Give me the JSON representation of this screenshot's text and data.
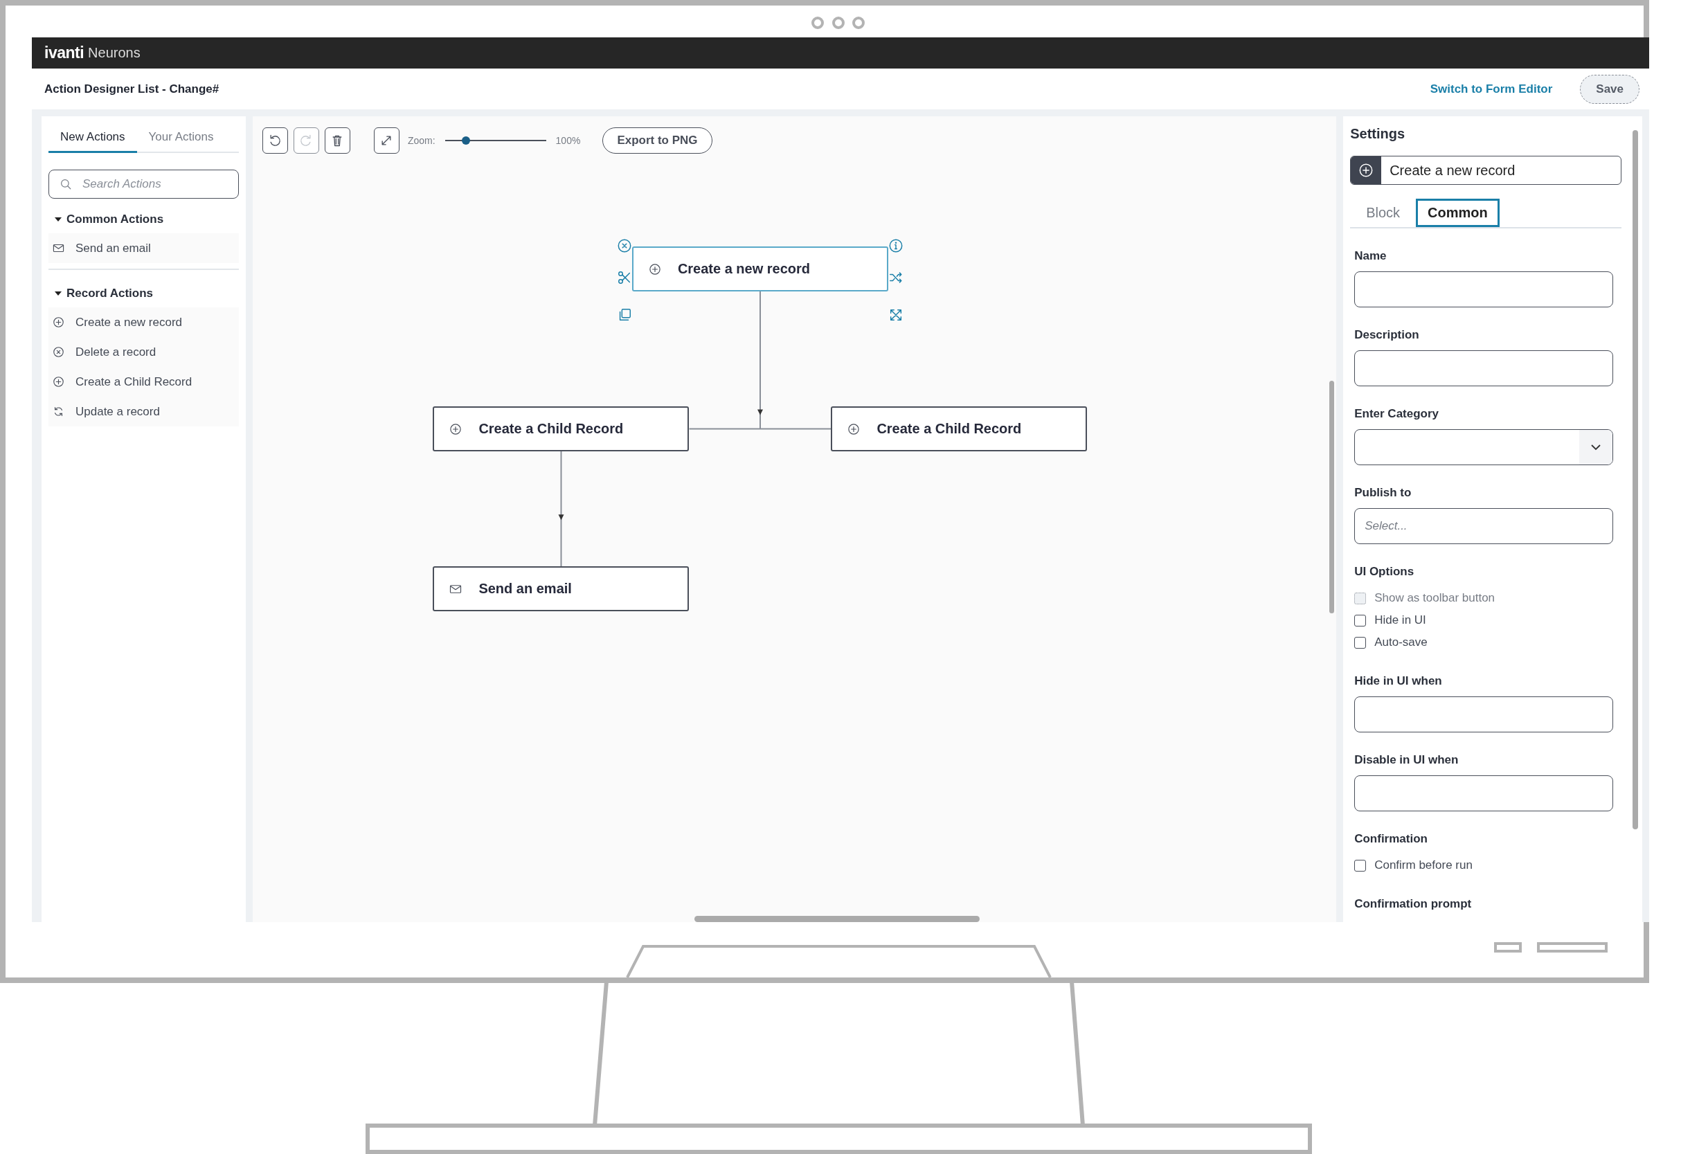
{
  "logo": {
    "brand": "ivanti",
    "product": "Neurons"
  },
  "header": {
    "title": "Action Designer List - Change#",
    "link": "Switch to Form Editor",
    "save_button": "Save"
  },
  "sidebar": {
    "tabs": [
      {
        "label": "New Actions",
        "selected": true
      },
      {
        "label": "Your Actions",
        "selected": false
      }
    ],
    "search": {
      "placeholder": "Search Actions"
    },
    "groups": [
      {
        "title": "Common Actions",
        "expanded": true,
        "items": [
          {
            "label": "Send an email",
            "kind": "mail"
          }
        ]
      },
      {
        "title": "Record Actions",
        "expanded": true,
        "items": [
          {
            "label": "Create a new record",
            "kind": "add"
          },
          {
            "label": "Delete a record",
            "kind": "remove"
          },
          {
            "label": "Create a Child Record",
            "kind": "add"
          },
          {
            "label": "Update a record",
            "kind": "sync"
          }
        ]
      }
    ]
  },
  "toolbar": {
    "buttons": [
      {
        "kind": "undo",
        "disabled": false
      },
      {
        "kind": "redo",
        "disabled": true
      },
      {
        "kind": "delete",
        "disabled": false
      },
      {
        "kind": "fit",
        "disabled": false
      }
    ],
    "zoom_label": "Zoom:",
    "zoom": {
      "level": 0.18
    },
    "zoom_reading": "100%",
    "export_button": "Export to PNG"
  },
  "canvas": {
    "nodes": [
      {
        "label": "Create a new record",
        "kind": "add",
        "selected": true,
        "children": [
          {
            "label": "Create a Child Record",
            "kind": "add",
            "selected": false,
            "children": [
              {
                "label": "Send an email",
                "kind": "mail",
                "selected": false
              }
            ]
          },
          {
            "label": "Create a Child Record",
            "kind": "add",
            "selected": false
          }
        ]
      }
    ]
  },
  "settings": {
    "title": "Settings",
    "block": {
      "label": "Create a new record",
      "kind": "add"
    },
    "tabs": [
      {
        "label": "Block",
        "selected": false
      },
      {
        "label": "Common",
        "selected": true
      }
    ],
    "sections": [
      {
        "kind": "input",
        "label": "Name"
      },
      {
        "kind": "input",
        "label": "Description"
      },
      {
        "kind": "select",
        "label": "Enter Category"
      },
      {
        "kind": "input",
        "label": "Publish to",
        "placeholder": "Select..."
      },
      {
        "kind": "checks",
        "label": "UI Options",
        "options": [
          {
            "label": "Show as toolbar button",
            "checked": false,
            "disabled": true
          },
          {
            "label": "Hide in UI",
            "checked": false,
            "disabled": false
          },
          {
            "label": "Auto-save",
            "checked": false,
            "disabled": false
          }
        ]
      },
      {
        "kind": "input",
        "label": "Hide in UI when"
      },
      {
        "kind": "input",
        "label": "Disable in UI when"
      },
      {
        "kind": "checks",
        "label": "Confirmation",
        "options": [
          {
            "label": "Confirm before run",
            "checked": false,
            "disabled": false
          }
        ]
      },
      {
        "kind": "heading",
        "label": "Confirmation prompt"
      }
    ]
  }
}
